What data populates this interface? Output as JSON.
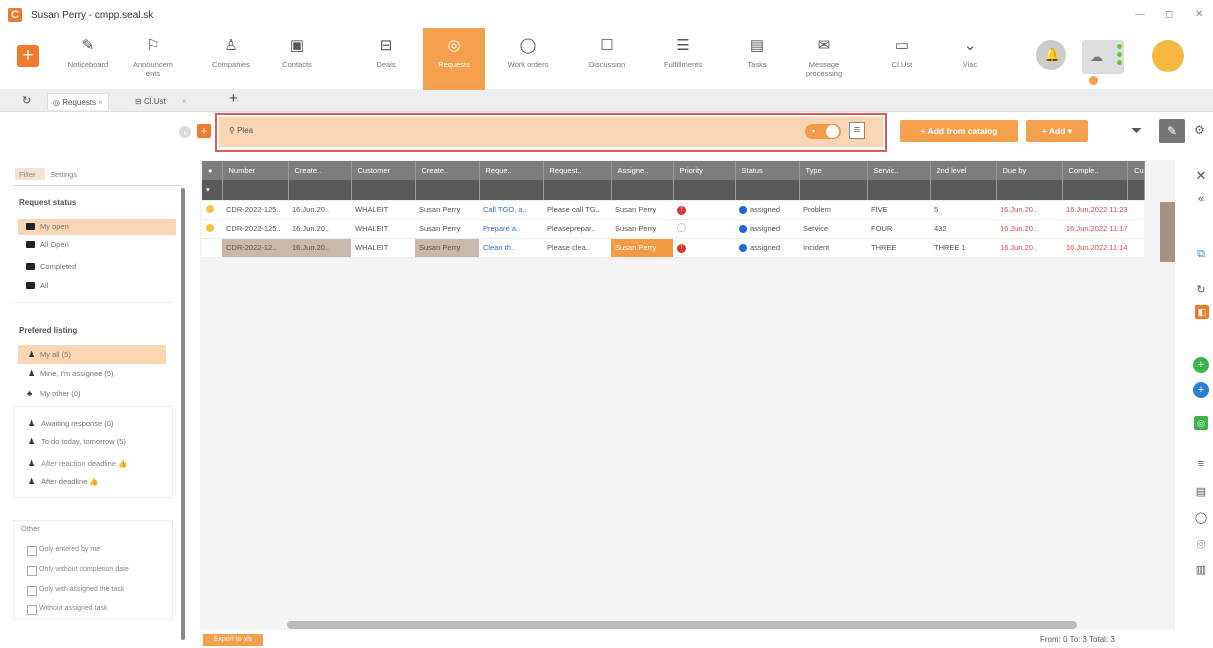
{
  "window": {
    "title": "Susan Perry - cmpp.seal.sk",
    "logo": "C",
    "minimize": "—",
    "maximize": "◻",
    "close": "✕"
  },
  "toolbar": {
    "items": [
      {
        "label": "Noticeboard",
        "icon": "✎"
      },
      {
        "label": "Announcem ents",
        "icon": "⚐"
      },
      {
        "label": "Companies",
        "icon": "♙"
      },
      {
        "label": "Contacts",
        "icon": "▣"
      },
      {
        "label": "Deals",
        "icon": "⊟"
      },
      {
        "label": "Requests",
        "icon": "◎"
      },
      {
        "label": "Work orders",
        "icon": "◯"
      },
      {
        "label": "Discussion",
        "icon": "☐"
      },
      {
        "label": "Fulfillments",
        "icon": "☰"
      },
      {
        "label": "Tasks",
        "icon": "▤"
      },
      {
        "label": "Message processing",
        "icon": "✉"
      },
      {
        "label": "Cl.Ust",
        "icon": "▭"
      },
      {
        "label": "Viac",
        "icon": "⌄"
      }
    ],
    "active": "Requests",
    "accent": "#f5a04c"
  },
  "tabs": [
    {
      "label": "Requests",
      "close": "×"
    },
    {
      "label": "Cl.Ust",
      "close": "×"
    }
  ],
  "tab_add": "+",
  "search": {
    "value": "Plea"
  },
  "buttons": {
    "add_catalog": "+ Add from catalog",
    "add": "+ Add ▾"
  },
  "sidebar": {
    "tabs": [
      "Filter",
      "Settings"
    ],
    "request_status_title": "Request status",
    "status_items": [
      "My open",
      "All Open",
      "Completed",
      "All"
    ],
    "preferred_title": "Prefered listing",
    "preferred_items": [
      "My all (5)",
      "Mine, I'm assignee (5)",
      "My other (0)"
    ],
    "sub_items": [
      "Awaiting response (0)",
      "To do today, tomorrow (5)",
      "After reaction deadline 👍",
      "After deadline 👍"
    ],
    "other_title": "Other",
    "checks": [
      "Only entered by me",
      "Only without completion date",
      "Only with assigned the task",
      "Without assigned task"
    ]
  },
  "table": {
    "headers": [
      "●",
      "Number",
      "Create..",
      "Customer",
      "Create..",
      "Reque..",
      "Request..",
      "Assigne..",
      "Priority",
      "Status",
      "Type",
      "Servic..",
      "2nd level",
      "Due by",
      "Comple..",
      "Cu"
    ],
    "rows": [
      [
        "",
        "CDR-2022-125..",
        "16.Jun.20..",
        "WHALEIT",
        "Susan Perry",
        "Call TGO, a..",
        "Please call TG..",
        "Susan Perry",
        "",
        "assigned",
        "Problem",
        "FIVE",
        "5",
        "16.Jun.20..",
        "16.Jun.2022 11:23",
        ""
      ],
      [
        "",
        "CDR-2022-125..",
        "16.Jun.20..",
        "WHALEIT",
        "Susan Perry",
        "Prepare a..",
        "Pleaseprepar..",
        "Susan Perry",
        "",
        "assigned",
        "Service",
        "FOUR",
        "432",
        "16.Jun.20..",
        "16.Jun.2022 11:17",
        ""
      ],
      [
        "",
        "CDR-2022-12..",
        "16.Jun.20..",
        "WHALEIT",
        "Susan Perry",
        "Clean th..",
        "Please clea..",
        "Susan Perry",
        "",
        "assigned",
        "Incident",
        "THREE",
        "THREE 1",
        "16.Jun.20..",
        "16.Jun.2022 11:14",
        ""
      ]
    ]
  },
  "footer": {
    "export": "Export to xls",
    "counts": "From: 0  To: 3  Total: 3"
  }
}
